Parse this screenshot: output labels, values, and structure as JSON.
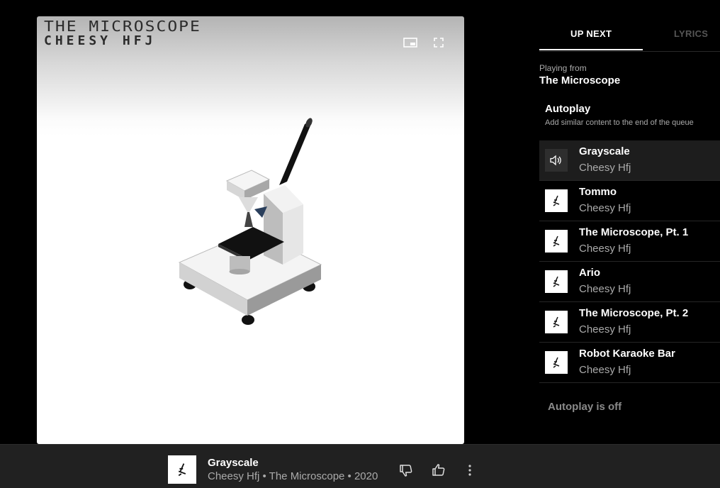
{
  "album_art": {
    "title_text": "THE MICROSCOPE",
    "artist_text": "CHEESY HFJ",
    "miniplayer_button": "miniplayer-icon",
    "fullscreen_button": "fullscreen-icon"
  },
  "tabs": [
    {
      "label": "UP NEXT",
      "selected": true
    },
    {
      "label": "LYRICS",
      "selected": false
    }
  ],
  "playing_from": {
    "label": "Playing from",
    "title": "The Microscope"
  },
  "autoplay": {
    "title": "Autoplay",
    "description": "Add similar content to the end of the queue",
    "status": "Autoplay is off"
  },
  "queue": [
    {
      "title": "Grayscale",
      "artist": "Cheesy Hfj",
      "now_playing": true
    },
    {
      "title": "Tommo",
      "artist": "Cheesy Hfj",
      "now_playing": false
    },
    {
      "title": "The Microscope, Pt. 1",
      "artist": "Cheesy Hfj",
      "now_playing": false
    },
    {
      "title": "Ario",
      "artist": "Cheesy Hfj",
      "now_playing": false
    },
    {
      "title": "The Microscope, Pt. 2",
      "artist": "Cheesy Hfj",
      "now_playing": false
    },
    {
      "title": "Robot Karaoke Bar",
      "artist": "Cheesy Hfj",
      "now_playing": false
    }
  ],
  "player_bar": {
    "title": "Grayscale",
    "subtitle": "Cheesy Hfj • The Microscope • 2020",
    "icons": [
      "dislike-icon",
      "like-icon",
      "more-options-icon"
    ]
  },
  "colors": {
    "background": "#000000",
    "bar_background": "#212121",
    "active_row": "#1d1d1d",
    "secondary_text": "#aaaaaa"
  }
}
